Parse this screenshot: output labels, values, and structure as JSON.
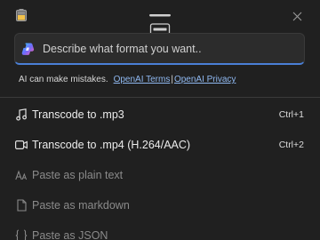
{
  "titlebar": {
    "app_icon": "battery-app-icon",
    "drag_handle_icon": "drag-handle-icon",
    "close_icon": "close-icon"
  },
  "prompt": {
    "icon": "copilot-icon",
    "placeholder": "Describe what format you want..",
    "value": ""
  },
  "disclaimer": {
    "text": "AI can make mistakes.",
    "terms_link": "OpenAI Terms",
    "separator": "|",
    "privacy_link": "OpenAI Privacy"
  },
  "menu": {
    "items": [
      {
        "icon": "music-note-icon",
        "label": "Transcode to .mp3",
        "shortcut": "Ctrl+1",
        "enabled": true
      },
      {
        "icon": "video-camera-icon",
        "label": "Transcode to .mp4 (H.264/AAC)",
        "shortcut": "Ctrl+2",
        "enabled": true
      },
      {
        "icon": "plain-text-icon",
        "label": "Paste as plain text",
        "shortcut": "",
        "enabled": false
      },
      {
        "icon": "markdown-document-icon",
        "label": "Paste as markdown",
        "shortcut": "",
        "enabled": false
      },
      {
        "icon": "json-braces-icon",
        "label": "Paste as JSON",
        "shortcut": "",
        "enabled": false
      }
    ]
  },
  "colors": {
    "background": "#202020",
    "accent": "#4a7fd6",
    "link": "#8fb8f0",
    "disabled_text": "#8a8a8a"
  }
}
